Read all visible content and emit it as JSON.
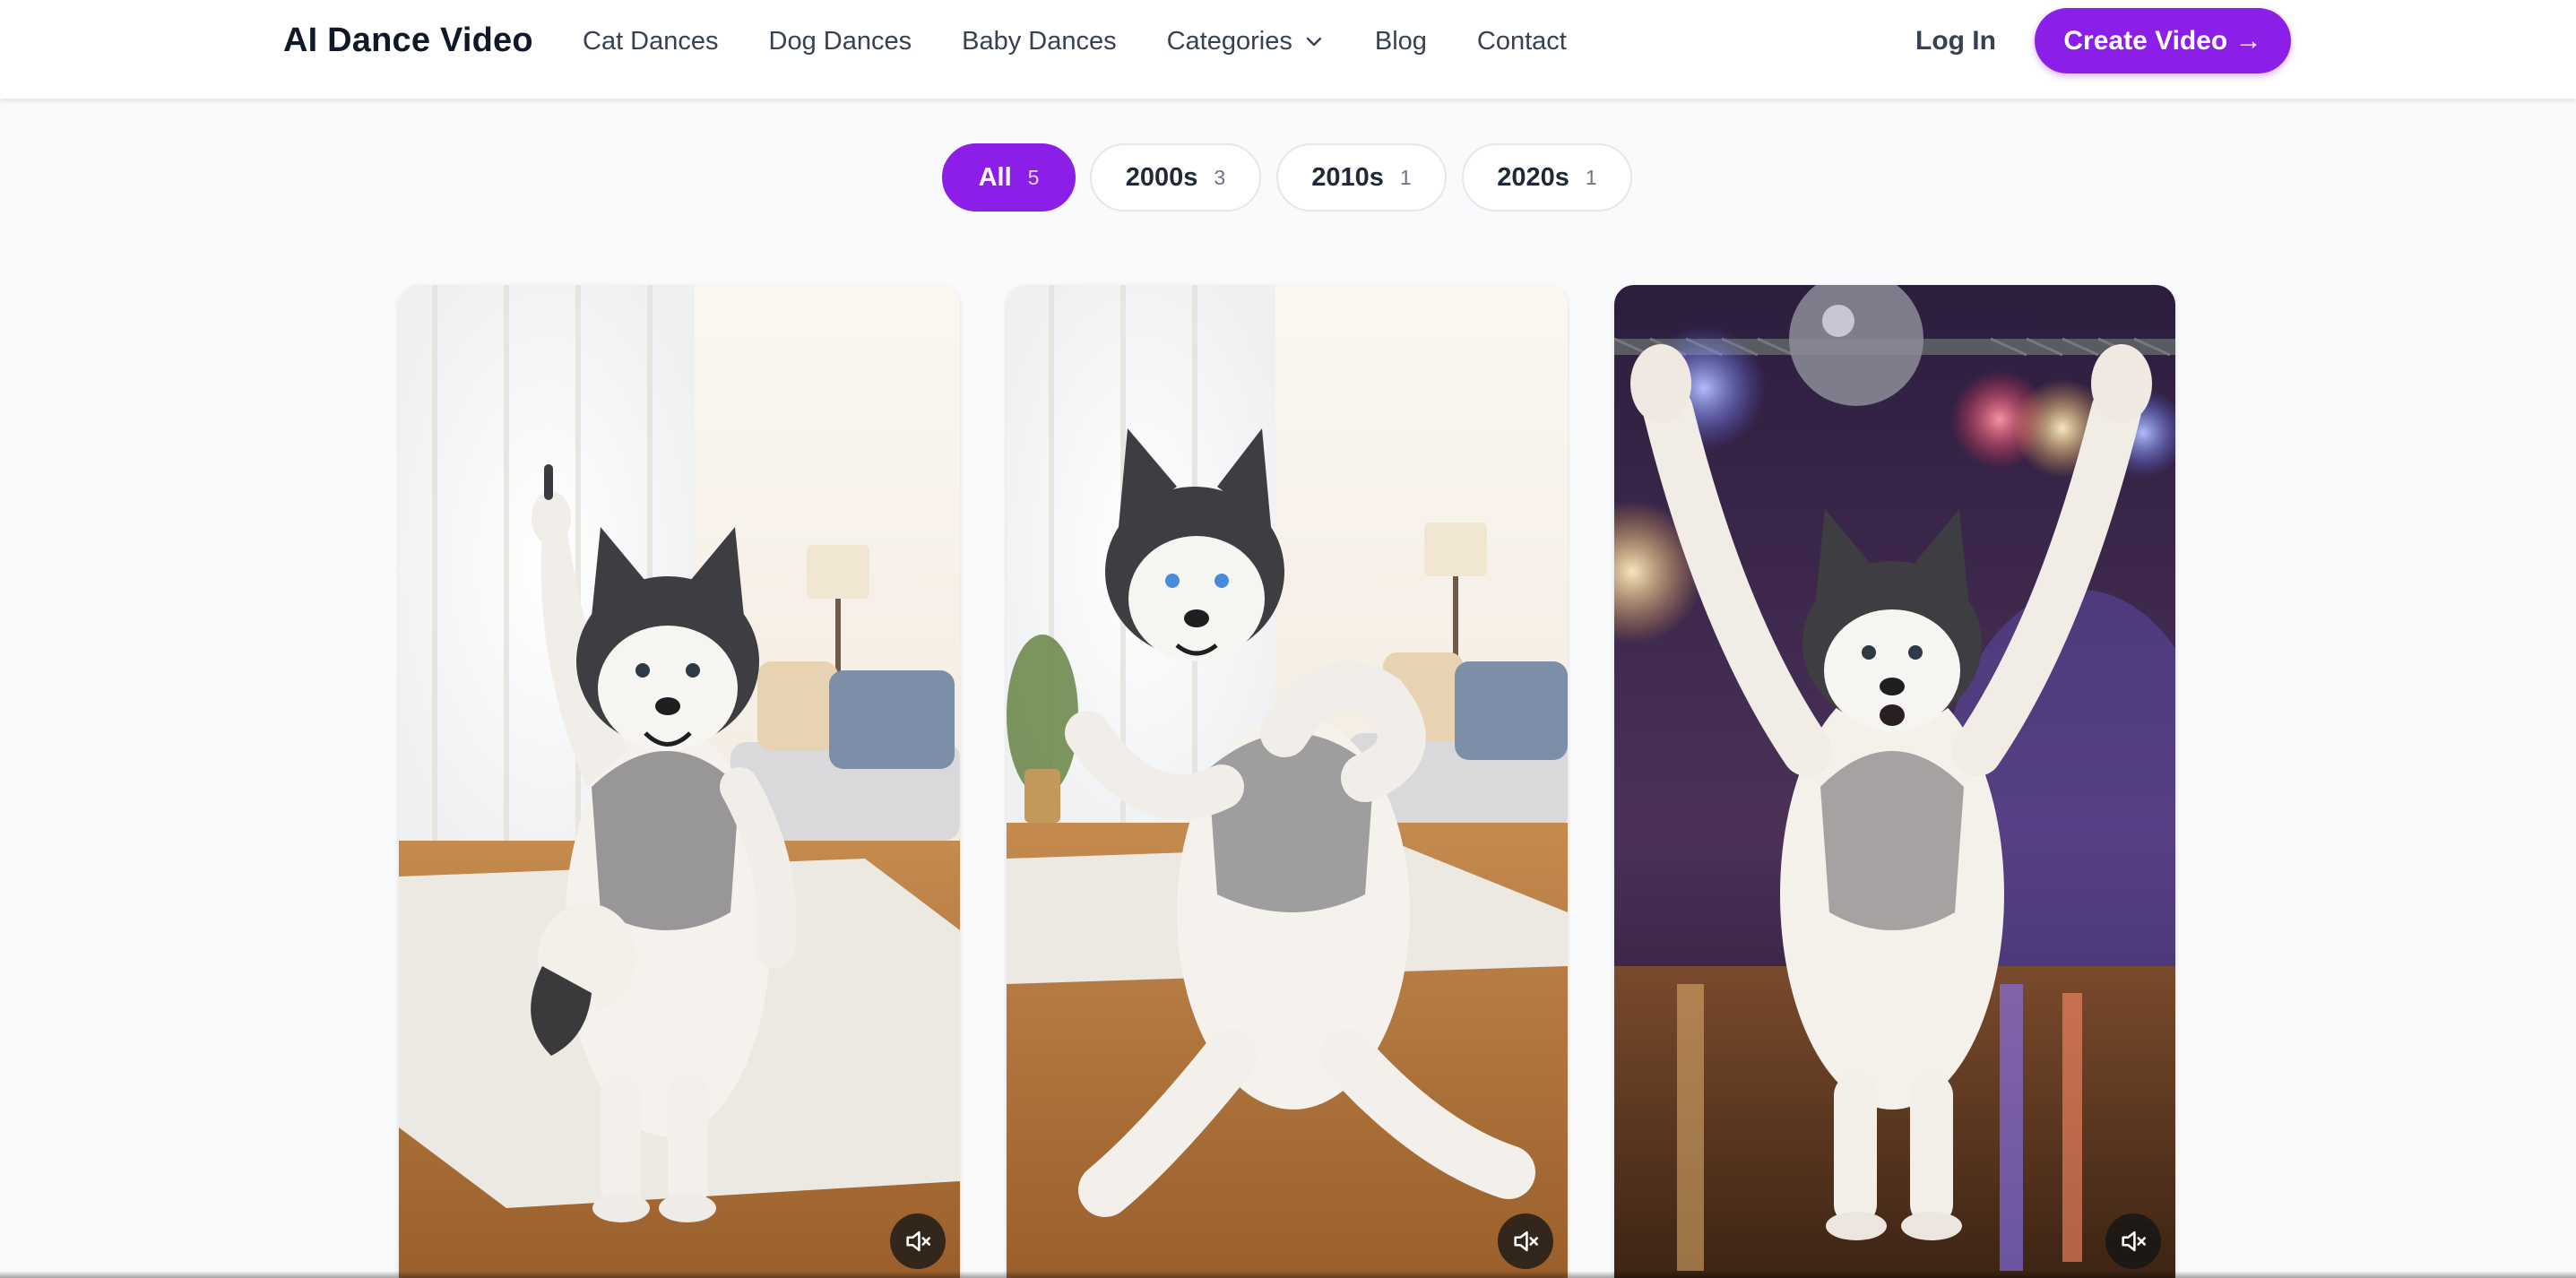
{
  "header": {
    "logo": "AI Dance Video",
    "nav": [
      {
        "label": "Cat Dances"
      },
      {
        "label": "Dog Dances"
      },
      {
        "label": "Baby Dances"
      },
      {
        "label": "Categories",
        "has_dropdown": true
      },
      {
        "label": "Blog"
      },
      {
        "label": "Contact"
      }
    ],
    "login": "Log In",
    "cta": "Create Video →"
  },
  "filters": [
    {
      "label": "All",
      "count": "5",
      "active": true
    },
    {
      "label": "2000s",
      "count": "3",
      "active": false
    },
    {
      "label": "2010s",
      "count": "1",
      "active": false
    },
    {
      "label": "2020s",
      "count": "1",
      "active": false
    }
  ],
  "videos": [
    {
      "scene": "living-room",
      "pose": "one-paw-up",
      "muted": true,
      "mute_icon": "speaker-muted-icon"
    },
    {
      "scene": "living-room",
      "pose": "dance-step",
      "muted": true,
      "mute_icon": "speaker-muted-icon"
    },
    {
      "scene": "disco-stage",
      "pose": "both-paws-up",
      "muted": true,
      "mute_icon": "speaker-muted-icon"
    }
  ],
  "colors": {
    "accent": "#8b1fe8",
    "page_bg": "#f8fafc",
    "header_bg": "#ffffff"
  }
}
